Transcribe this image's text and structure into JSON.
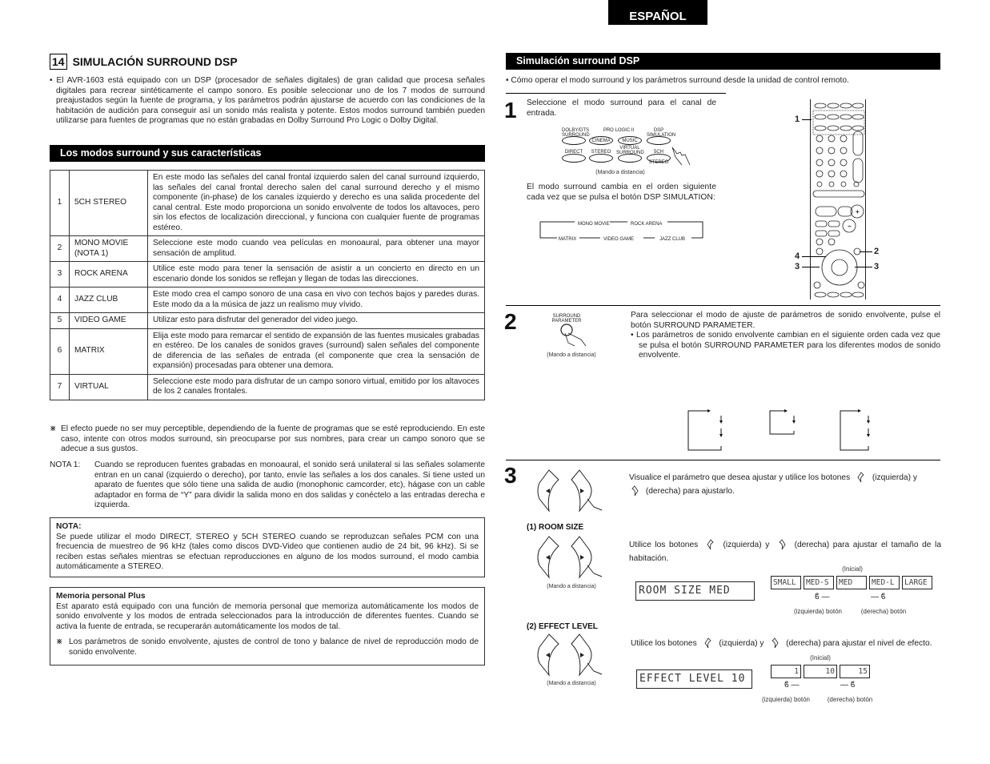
{
  "lang_tab": "ESPAÑOL",
  "left": {
    "section_number": "14",
    "section_title": "SIMULACIÓN SURROUND DSP",
    "intro": "• El AVR-1603 está equipado con un DSP (procesador de señales digitales) de gran calidad que procesa señales digitales para recrear sintéticamente el campo sonoro. Es posible seleccionar uno de los 7 modos de surround preajustados según la fuente de programa, y los parámetros podrán ajustarse de acuerdo con las condiciones de la habitación de audición para conseguir así un sonido más realista y potente. Estos modos surround también pueden utilizarse para fuentes de programas que no están grabadas en Dolby Surround Pro Logic o Dolby Digital.",
    "modes_heading": "Los modos surround y sus características",
    "modes": [
      {
        "num": "1",
        "name": "5CH STEREO",
        "desc": "En este modo las señales del canal frontal izquierdo salen del canal surround izquierdo, las señales del canal frontal derecho salen del canal surround derecho y el mismo componente (in-phase) de los canales izquierdo y derecho es una salida procedente del canal central. Este modo proporciona un sonido envolvente de todos los altavoces, pero sin los efectos de localización direccional, y funciona con cualquier fuente de programas estéreo."
      },
      {
        "num": "2",
        "name": "MONO MOVIE (NOTA 1)",
        "desc": "Seleccione este modo cuando vea películas en monoaural, para obtener una mayor sensación de amplitud."
      },
      {
        "num": "3",
        "name": "ROCK ARENA",
        "desc": "Utilice este modo para tener la sensación de asistir a un concierto en directo en un escenario donde los sonidos se reflejan y llegan de todas las direcciones."
      },
      {
        "num": "4",
        "name": "JAZZ CLUB",
        "desc": "Este modo crea el campo sonoro de una casa en vivo con techos bajos y paredes duras. Este modo da a la música de jazz un realismo muy vívido."
      },
      {
        "num": "5",
        "name": "VIDEO GAME",
        "desc": "Utilizar esto para disfrutar del generador del video juego."
      },
      {
        "num": "6",
        "name": "MATRIX",
        "desc": "Elija este modo para remarcar el sentido de expansión de las fuentes musicales grabadas en estéreo. De los canales de sonidos graves (surround) salen señales del componente de diferencia de las señales de entrada (el componente que crea la sensación de expansión) procesadas para obtener una demora."
      },
      {
        "num": "7",
        "name": "VIRTUAL",
        "desc": "Seleccione este modo para disfrutar de un campo sonoro virtual, emitido por los altavoces de los 2 canales frontales."
      }
    ],
    "footnote_mark": "⋇",
    "footnote": "El efecto puede no ser muy perceptible, dependiendo de la fuente de programas que se esté reproduciendo. En este caso, intente con otros modos surround, sin preocuparse por sus nombres, para crear un campo sonoro que se adecue a sus gustos.",
    "nota1_label": "NOTA 1:",
    "nota1": "Cuando se reproducen fuentes grabadas en monoaural, el sonido será unilateral si las señales solamente entran en un canal (izquierdo o derecho), por tanto, envíe las señales a los dos canales. Si tiene usted un aparato de fuentes que sólo tiene una salida de audio (monophonic camcorder, etc), hágase con un cable adaptador en forma de “Y” para dividir la salida mono en dos salidas y conéctelo a las entradas derecha e izquierda.",
    "nota_box": {
      "title": "NOTA:",
      "text": "Se puede utilizar el modo DIRECT, STEREO y 5CH STEREO cuando se reproduzcan señales PCM  con una frecuencia de muestreo de 96 kHz (tales como discos DVD-Video que contienen audio de 24 bit, 96 kHz). Si se reciben estas señales mientras se efectuan reproducciones en alguno de los modos surround, el modo cambia automáticamente a STEREO."
    },
    "memory_box": {
      "title": "Memoria personal Plus",
      "text": "Est aparato está equipado con una función de memoria personal que memoriza automáticamente los modos de sonido envolvente y los modos de entrada seleccionados para la introducción de diferentes fuentes. Cuando se activa la fuente de entrada, se recuperarán automáticamente los modos de tal.",
      "foot_mark": "⋇",
      "foot": "Los parámetros de sonido envolvente, ajustes de control de tono y balance de nivel de reproducción modo de sonido envolvente."
    }
  },
  "right": {
    "heading": "Simulación surround DSP",
    "intro": "• Cómo operar el modo surround y los parámetros surround desde la unidad de control remoto.",
    "step1": {
      "number": "1",
      "text": "Seleccione el modo surround para el canal de entrada.",
      "remote_buttons": {
        "row1": [
          "DOLBY/DTS SURROUND",
          "CINEMA",
          "MUSIC",
          "DSP SIMULATION"
        ],
        "prologic_label": "PRO LOGIC II",
        "row2": [
          "DIRECT",
          "STEREO",
          "VIRTUAL SURROUND",
          "5CH STEREO"
        ]
      },
      "caption": "(Mando a distancia)",
      "text2": "El modo surround cambia en el orden siguiente cada vez que se pulsa el botón DSP SIMULATION:",
      "cycle": [
        "MONO MOVIE",
        "ROCK ARENA",
        "JAZZ CLUB",
        "VIDEO GAME",
        "MATRIX"
      ],
      "remote_callouts": [
        "1",
        "2",
        "3",
        "3",
        "4"
      ]
    },
    "step2": {
      "number": "2",
      "button_label": "SURROUND PARAMETER",
      "caption": "(Mando a distancia)",
      "text": "Para seleccionar el modo de ajuste de parámetros de sonido envolvente, pulse el botón SURROUND PARAMETER.",
      "bullet": "• Los parámetros de sonido envolvente cambian en el siguiente orden cada vez que se pulsa el botón SURROUND PARAMETER para los diferentes modos de sonido envolvente."
    },
    "step3": {
      "number": "3",
      "text_a": "Visualice el parámetro que desea ajustar y utilice los botones",
      "text_b": "(izquierda) y",
      "text_c": "(derecha) para ajustarlo.",
      "room_size": {
        "heading": "(1) ROOM SIZE",
        "text_a": "Utilice los botones",
        "text_b": "(izquierda) y",
        "text_c": "(derecha) para ajustar el tamaño de la habitación.",
        "caption": "(Mando a distancia)",
        "display": "ROOM SIZE MED",
        "initial_label": "(Inicial)",
        "options": [
          "SMALL",
          "MED-S",
          "MED",
          "MED-L",
          "LARGE"
        ],
        "left_label": "(izquierda) botón",
        "right_label": "(derecha) botón"
      },
      "effect_level": {
        "heading": "(2) EFFECT LEVEL",
        "text_a": "Utilice los botones",
        "text_b": "(izquierda) y",
        "text_c": "(derecha) para ajustar el nivel de efecto.",
        "caption": "(Mando a distancia)",
        "display": "EFFECT LEVEL 10",
        "initial_label": "(Inicial)",
        "options": [
          "1",
          "10",
          "15"
        ],
        "left_label": "(izquierda) botón",
        "right_label": "(derecha) botón"
      }
    }
  }
}
